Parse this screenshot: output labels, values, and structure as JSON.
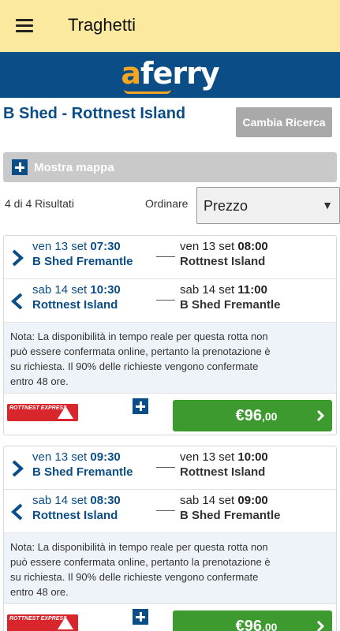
{
  "appbar": {
    "title": "Traghetti"
  },
  "brand": {
    "logo_a": "a",
    "logo_rest": "ferry"
  },
  "route": {
    "title": "B Shed - Rottnest Island",
    "change_button": "Cambia Ricerca"
  },
  "map_toggle": {
    "label": "Mostra mappa"
  },
  "results": {
    "count_label": "4 di 4 Risultati",
    "sort_label": "Ordinare",
    "sort_value": "Prezzo"
  },
  "cards": [
    {
      "outbound": {
        "dep_day": "ven 13 set",
        "dep_time": "07:30",
        "dep_port": "B Shed Fremantle",
        "arr_day": "ven 13 set",
        "arr_time": "08:00",
        "arr_port": "Rottnest Island"
      },
      "return": {
        "dep_day": "sab 14 set",
        "dep_time": "10:30",
        "dep_port": "Rottnest Island",
        "arr_day": "sab 14 set",
        "arr_time": "11:00",
        "arr_port": "B Shed Fremantle"
      },
      "note": "Nota: La disponibilità in tempo reale per questa rotta non può essere confermata online, pertanto la prenotazione è su richiesta. Il 90% delle richieste vengono confermate entro 48 ore.",
      "operator": "ROTTNEST EXPRESS",
      "price_main": "€96",
      "price_cents": ",00"
    },
    {
      "outbound": {
        "dep_day": "ven 13 set",
        "dep_time": "09:30",
        "dep_port": "B Shed Fremantle",
        "arr_day": "ven 13 set",
        "arr_time": "10:00",
        "arr_port": "Rottnest Island"
      },
      "return": {
        "dep_day": "sab 14 set",
        "dep_time": "08:30",
        "dep_port": "Rottnest Island",
        "arr_day": "sab 14 set",
        "arr_time": "09:00",
        "arr_port": "B Shed Fremantle"
      },
      "note": "Nota: La disponibilità in tempo reale per questa rotta non può essere confermata online, pertanto la prenotazione è su richiesta. Il 90% delle richieste vengono confermate entro 48 ore.",
      "operator": "ROTTNEST EXPRESS",
      "price_main": "€96",
      "price_cents": ",00"
    }
  ],
  "colors": {
    "appbar": "#fbe9a0",
    "brand": "#0b4d86",
    "accent": "#f5a623",
    "price_button": "#3d9a2f"
  }
}
